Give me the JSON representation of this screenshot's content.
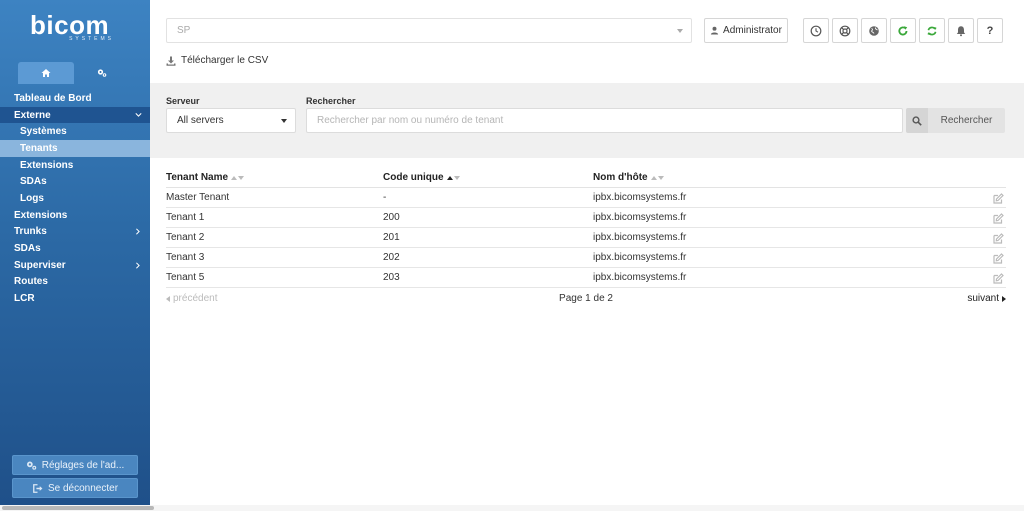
{
  "brand": {
    "name": "bicom",
    "tagline": "SYSTEMS"
  },
  "sidebar": {
    "tabs": [
      {
        "icon": "home-icon"
      },
      {
        "icon": "gears-icon"
      }
    ],
    "items": [
      {
        "label": "Tableau de Bord"
      },
      {
        "label": "Externe",
        "expanded": true
      },
      {
        "label": "Systèmes"
      },
      {
        "label": "Tenants",
        "selected": true
      },
      {
        "label": "Extensions"
      },
      {
        "label": "SDAs"
      },
      {
        "label": "Logs"
      },
      {
        "label": "Extensions"
      },
      {
        "label": "Trunks"
      },
      {
        "label": "SDAs"
      },
      {
        "label": "Superviser"
      },
      {
        "label": "Routes"
      },
      {
        "label": "LCR"
      }
    ],
    "admin_settings": "Réglages de l'ad...",
    "logout": "Se déconnecter"
  },
  "topbar": {
    "tenant_select": "SP",
    "user": "Administrator",
    "tools": [
      "clock-icon",
      "lifebuoy-icon",
      "globe-icon",
      "reload-icon",
      "refresh-icon",
      "bell-icon",
      "help-icon"
    ],
    "help_glyph": "?"
  },
  "csv": {
    "label": "Télécharger le CSV"
  },
  "filters": {
    "server_label": "Serveur",
    "server_value": "All servers",
    "search_label": "Rechercher",
    "search_placeholder": "Rechercher par nom ou numéro de tenant",
    "search_value": "",
    "search_button": "Rechercher"
  },
  "table": {
    "columns": [
      "Tenant Name",
      "Code unique",
      "Nom d'hôte"
    ],
    "rows": [
      [
        "Master Tenant",
        "-",
        "ipbx.bicomsystems.fr"
      ],
      [
        "Tenant 1",
        "200",
        "ipbx.bicomsystems.fr"
      ],
      [
        "Tenant 2",
        "201",
        "ipbx.bicomsystems.fr"
      ],
      [
        "Tenant 3",
        "202",
        "ipbx.bicomsystems.fr"
      ],
      [
        "Tenant 5",
        "203",
        "ipbx.bicomsystems.fr"
      ]
    ]
  },
  "pager": {
    "prev": "précédent",
    "page": "Page 1 de 2",
    "next": "suivant"
  },
  "colors": {
    "sidebar_top": "#3d83c2",
    "sidebar_bottom": "#1f5089",
    "green_action": "#3aa83a"
  }
}
